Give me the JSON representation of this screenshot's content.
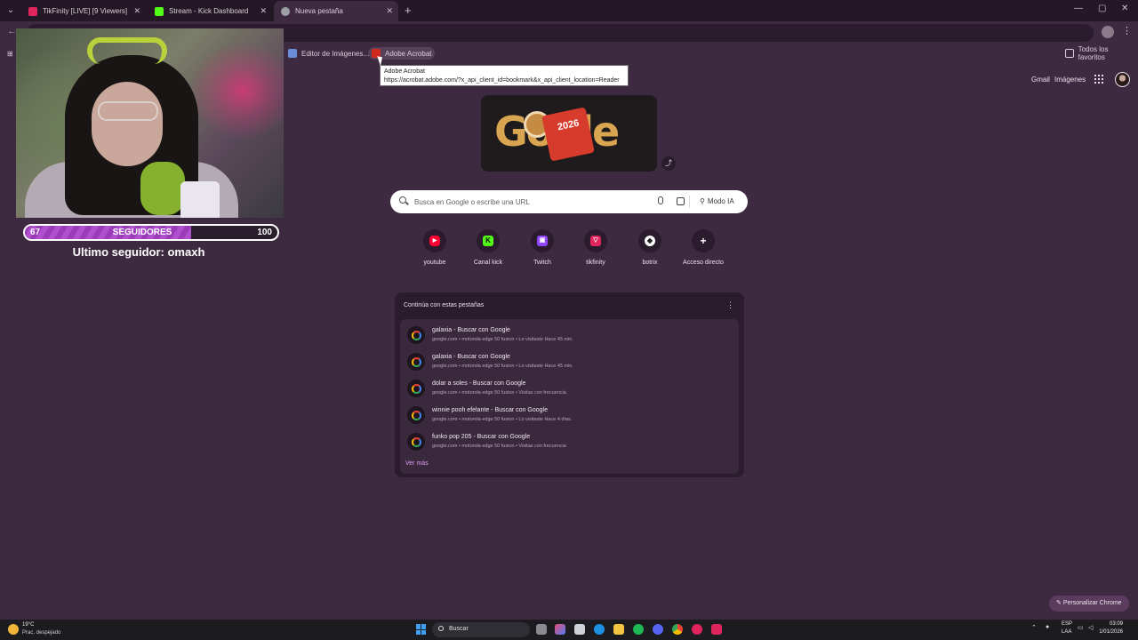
{
  "tabs": [
    {
      "title": "TikFinity [LIVE] [9 Viewers]",
      "color": "#e0245e"
    },
    {
      "title": "Stream - Kick Dashboard",
      "color": "#53fc18"
    },
    {
      "title": "Nueva pestaña",
      "color": "#9aa0a6"
    }
  ],
  "bookmarks": {
    "items": [
      {
        "label": "Editor de Imágenes...",
        "color": "#6b8cd6"
      },
      {
        "label": "Adobe Acrobat",
        "color": "#d1281c"
      }
    ],
    "all_favorites": "Todos los favoritos"
  },
  "tooltip": {
    "title": "Adobe Acrobat",
    "url": "https://acrobat.adobe.com/?x_api_client_id=bookmark&x_api_client_location=Reader"
  },
  "overlay": {
    "followers_min": "67",
    "followers_label": "SEGUIDORES",
    "followers_max": "100",
    "followers_progress": 0.66,
    "last_follower": "Ultimo seguidor: omaxh"
  },
  "header": {
    "gmail": "Gmail",
    "images": "Imágenes"
  },
  "doodle": {
    "text": "Gogle",
    "year": "2026"
  },
  "search": {
    "placeholder": "Busca en Google o escribe una URL",
    "ai_mode": "Modo IA"
  },
  "shortcuts": [
    {
      "label": "youtube",
      "color": "#ff0033",
      "glyph": "▶"
    },
    {
      "label": "Canal kick",
      "color": "#53fc18",
      "glyph": "K"
    },
    {
      "label": "Twitch",
      "color": "#9146ff",
      "glyph": "▣"
    },
    {
      "label": "tikfinity",
      "color": "#e0245e",
      "glyph": "▽"
    },
    {
      "label": "botrix",
      "color": "#ffffff",
      "glyph": "◆"
    },
    {
      "label": "Acceso directo",
      "color": "",
      "glyph": "+"
    }
  ],
  "continue_tabs": {
    "title": "Continúa con estas pestañas",
    "items": [
      {
        "name": "galaxia - Buscar con Google",
        "meta": "google.com • motorola edge 50 fusion • Lo visitaste Hace 45 min."
      },
      {
        "name": "galaxia - Buscar con Google",
        "meta": "google.com • motorola edge 50 fusion • Lo visitaste Hace 45 min."
      },
      {
        "name": "dolar a soles - Buscar con Google",
        "meta": "google.com • motorola edge 50 fusion • Visitas con frecuencia"
      },
      {
        "name": "winnie pooh efelante - Buscar con Google",
        "meta": "google.com • motorola edge 50 fusion • Lo visitaste Hace 4 días."
      },
      {
        "name": "funko pop 205 - Buscar con Google",
        "meta": "google.com • motorola edge 50 fusion • Visitas con frecuencia"
      }
    ],
    "more": "Ver más"
  },
  "customize": "Personalizar Chrome",
  "taskbar": {
    "weather_temp": "19°C",
    "weather_desc": "Prac. despejado",
    "search_label": "Buscar",
    "lang1": "ESP",
    "lang2": "LAA",
    "time": "03:09",
    "date": "1/01/2026"
  }
}
